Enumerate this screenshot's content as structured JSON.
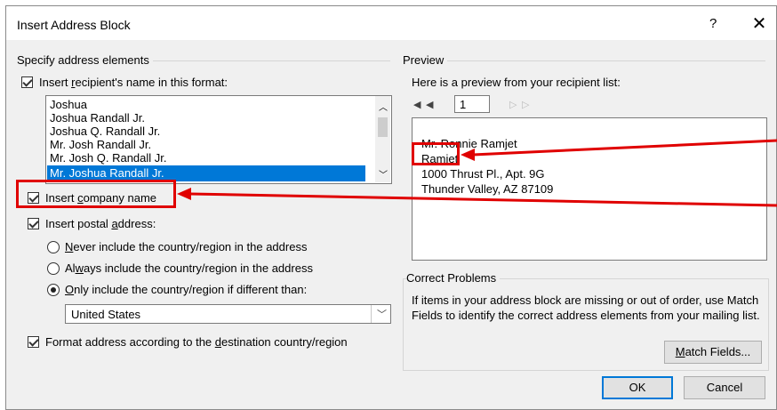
{
  "dialog": {
    "title": "Insert Address Block",
    "help_label": "?",
    "close_label": "✕"
  },
  "specify": {
    "group_label": "Specify address elements",
    "name_format_label": {
      "pre": "Insert ",
      "u": "r",
      "post": "ecipient's name in this format:"
    },
    "name_formats": [
      "Joshua",
      "Joshua Randall Jr.",
      "Joshua Q. Randall Jr.",
      "Mr. Josh Randall Jr.",
      "Mr. Josh Q. Randall Jr.",
      "Mr. Joshua Randall Jr."
    ],
    "selected_index": 5,
    "company_label": {
      "pre": "Insert ",
      "u": "c",
      "post": "ompany name"
    },
    "postal_label": {
      "pre": "Insert postal ",
      "u": "a",
      "post": "ddress:"
    },
    "radio_never": {
      "pre": "",
      "u": "N",
      "post": "ever include the country/region in the address"
    },
    "radio_always": {
      "pre": "Al",
      "u": "w",
      "post": "ays include the country/region in the address"
    },
    "radio_only": {
      "pre": "",
      "u": "O",
      "post": "nly include the country/region if different than:"
    },
    "country_value": "United States",
    "format_label": {
      "pre": "Format address according to the ",
      "u": "d",
      "post": "estination country/region"
    }
  },
  "preview": {
    "group_label": "Preview",
    "intro": "Here is a preview from your recipient list:",
    "record_number": "1",
    "lines": [
      "Mr. Ronnie Ramjet",
      "Ramjet",
      "1000 Thrust Pl., Apt. 9G",
      "Thunder Valley, AZ 87109"
    ]
  },
  "correct": {
    "group_label": "Correct Problems",
    "text": "If items in your address block are missing or out of order, use Match Fields to identify the correct address elements from your mailing list.",
    "match_button": {
      "pre": "",
      "u": "M",
      "post": "atch Fields..."
    }
  },
  "buttons": {
    "ok": "OK",
    "cancel": "Cancel"
  },
  "accent_colors": {
    "selection": "#0078d7",
    "annotation": "#e00000"
  }
}
